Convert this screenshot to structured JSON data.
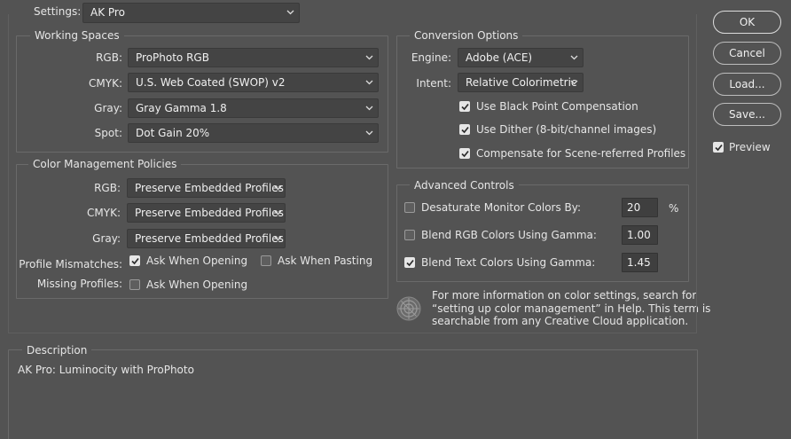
{
  "settings": {
    "label": "Settings:",
    "value": "AK Pro"
  },
  "working_spaces": {
    "title": "Working Spaces",
    "rgb": {
      "label": "RGB:",
      "value": "ProPhoto RGB"
    },
    "cmyk": {
      "label": "CMYK:",
      "value": "U.S. Web Coated (SWOP) v2"
    },
    "gray": {
      "label": "Gray:",
      "value": "Gray Gamma 1.8"
    },
    "spot": {
      "label": "Spot:",
      "value": "Dot Gain 20%"
    }
  },
  "color_management_policies": {
    "title": "Color Management Policies",
    "rgb": {
      "label": "RGB:",
      "value": "Preserve Embedded Profiles"
    },
    "cmyk": {
      "label": "CMYK:",
      "value": "Preserve Embedded Profiles"
    },
    "gray": {
      "label": "Gray:",
      "value": "Preserve Embedded Profiles"
    },
    "profile_mismatches": {
      "label": "Profile Mismatches:",
      "ask_when_opening": {
        "label": "Ask When Opening",
        "checked": true
      },
      "ask_when_pasting": {
        "label": "Ask When Pasting",
        "checked": false
      }
    },
    "missing_profiles": {
      "label": "Missing Profiles:",
      "ask_when_opening": {
        "label": "Ask When Opening",
        "checked": false
      }
    }
  },
  "conversion_options": {
    "title": "Conversion Options",
    "engine": {
      "label": "Engine:",
      "value": "Adobe (ACE)"
    },
    "intent": {
      "label": "Intent:",
      "value": "Relative Colorimetric"
    },
    "black_point": {
      "label": "Use Black Point Compensation",
      "checked": true
    },
    "dither": {
      "label": "Use Dither (8-bit/channel images)",
      "checked": true
    },
    "scene_referred": {
      "label": "Compensate for Scene-referred Profiles",
      "checked": true
    }
  },
  "advanced_controls": {
    "title": "Advanced Controls",
    "desaturate": {
      "label": "Desaturate Monitor Colors By:",
      "checked": false,
      "value": "20",
      "unit": "%"
    },
    "blend_rgb": {
      "label": "Blend RGB Colors Using Gamma:",
      "checked": false,
      "value": "1.00"
    },
    "blend_text": {
      "label": "Blend Text Colors Using Gamma:",
      "checked": true,
      "value": "1.45"
    }
  },
  "info": {
    "line1": "For more information on color settings, search for",
    "line2": "“setting up color management” in Help. This term is",
    "line3": "searchable from any Creative Cloud application."
  },
  "description": {
    "title": "Description",
    "text": "AK Pro:  Luminocity with ProPhoto"
  },
  "buttons": {
    "ok": "OK",
    "cancel": "Cancel",
    "load": "Load...",
    "save": "Save..."
  },
  "preview": {
    "label": "Preview",
    "checked": true
  },
  "icons": {
    "dropdown": "chevron-down-icon",
    "checkbox": "checkmark-icon",
    "info": "color-wheel-icon"
  },
  "colors": {
    "background": "#535353",
    "field": "#444444",
    "border": "#6a6a6a",
    "text": "#e6e6e6"
  }
}
